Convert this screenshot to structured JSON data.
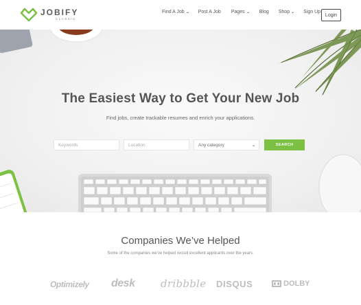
{
  "colors": {
    "accent": "#7cc144",
    "text": "#555555",
    "hero_bg": "#f1f1f1"
  },
  "brand": {
    "name": "JOBIFY",
    "tagline": "CLASSIC"
  },
  "nav": {
    "items": [
      {
        "label": "Find A Job",
        "dropdown": true
      },
      {
        "label": "Post A Job",
        "dropdown": false
      },
      {
        "label": "Pages",
        "dropdown": true
      },
      {
        "label": "Blog",
        "dropdown": false
      },
      {
        "label": "Shop",
        "dropdown": true
      },
      {
        "label": "Sign Up",
        "dropdown": false
      }
    ],
    "login_label": "Login",
    "dropdown_icon": "chevron-down-icon"
  },
  "hero": {
    "title": "The Easiest Way to Get Your New Job",
    "subtitle": "Find jobs, create trackable resumes and enrich your applications.",
    "search": {
      "keywords_placeholder": "Keywords",
      "location_placeholder": "Location",
      "category_value": "Any category",
      "button_label": "SEARCH"
    }
  },
  "companies": {
    "title": "Companies We’ve Helped",
    "subtitle": "Some of the companies we’ve helped recruit excellent applicants over the years.",
    "logos": [
      "Optimizely",
      "desk",
      "dribbble",
      "DISQUS",
      "DOLBY"
    ]
  }
}
